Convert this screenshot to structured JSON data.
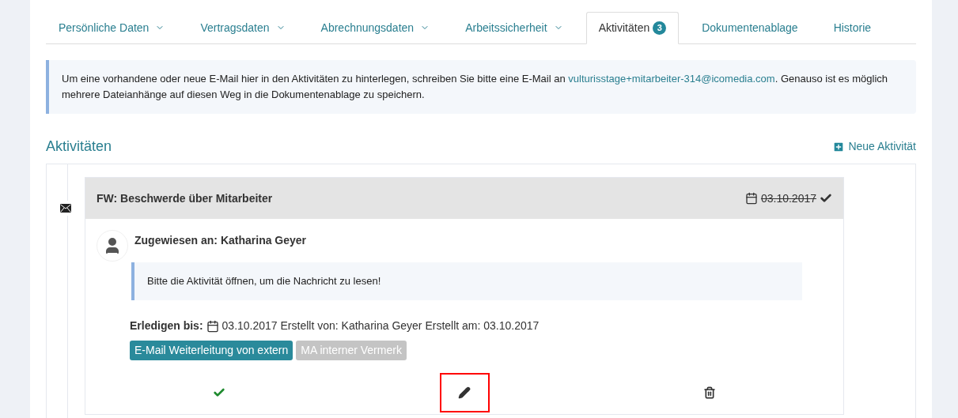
{
  "tabs": [
    {
      "label": "Persönliche Daten",
      "dropdown": true,
      "selected": false
    },
    {
      "label": "Vertragsdaten",
      "dropdown": true,
      "selected": false
    },
    {
      "label": "Abrechnungsdaten",
      "dropdown": true,
      "selected": false
    },
    {
      "label": "Arbeitssicherheit",
      "dropdown": true,
      "selected": false
    },
    {
      "label": "Aktivitäten",
      "dropdown": false,
      "badge": "3",
      "selected": true
    },
    {
      "label": "Dokumentenablage",
      "dropdown": false,
      "selected": false
    },
    {
      "label": "Historie",
      "dropdown": false,
      "selected": false
    }
  ],
  "info": {
    "text_before": "Um eine vorhandene oder neue E-Mail hier in den Aktivitäten zu hinterlegen, schreiben Sie bitte eine E-Mail an ",
    "link": "vulturisstage+mitarbeiter-314@icomedia.com",
    "text_after": ". Genauso ist es möglich mehrere Dateianhänge auf diesen Weg in die Dokumentenablage zu speichern."
  },
  "section": {
    "title": "Aktivitäten",
    "new_button": "Neue Aktivität"
  },
  "activities": [
    {
      "kind": "email",
      "title": "FW: Beschwerde über Mitarbeiter",
      "date": "03.10.2017",
      "done": true,
      "assigned": "Zugewiesen an: Katharina Geyer",
      "message": "Bitte die Aktivität öffnen, um die Nachricht zu lesen!",
      "due_label": "Erledigen bis:",
      "meta": "03.10.2017 Erstellt von: Katharina Geyer Erstellt am: 03.10.2017",
      "tags": [
        {
          "label": "E-Mail Weiterleitung von extern",
          "color": "#2a8a9b"
        },
        {
          "label": "MA interner Vermerk",
          "color": "#c4c4c4"
        }
      ],
      "actions": [
        {
          "kind": "complete",
          "highlighted": false
        },
        {
          "kind": "edit",
          "highlighted": true
        },
        {
          "kind": "delete",
          "highlighted": false
        }
      ]
    }
  ]
}
